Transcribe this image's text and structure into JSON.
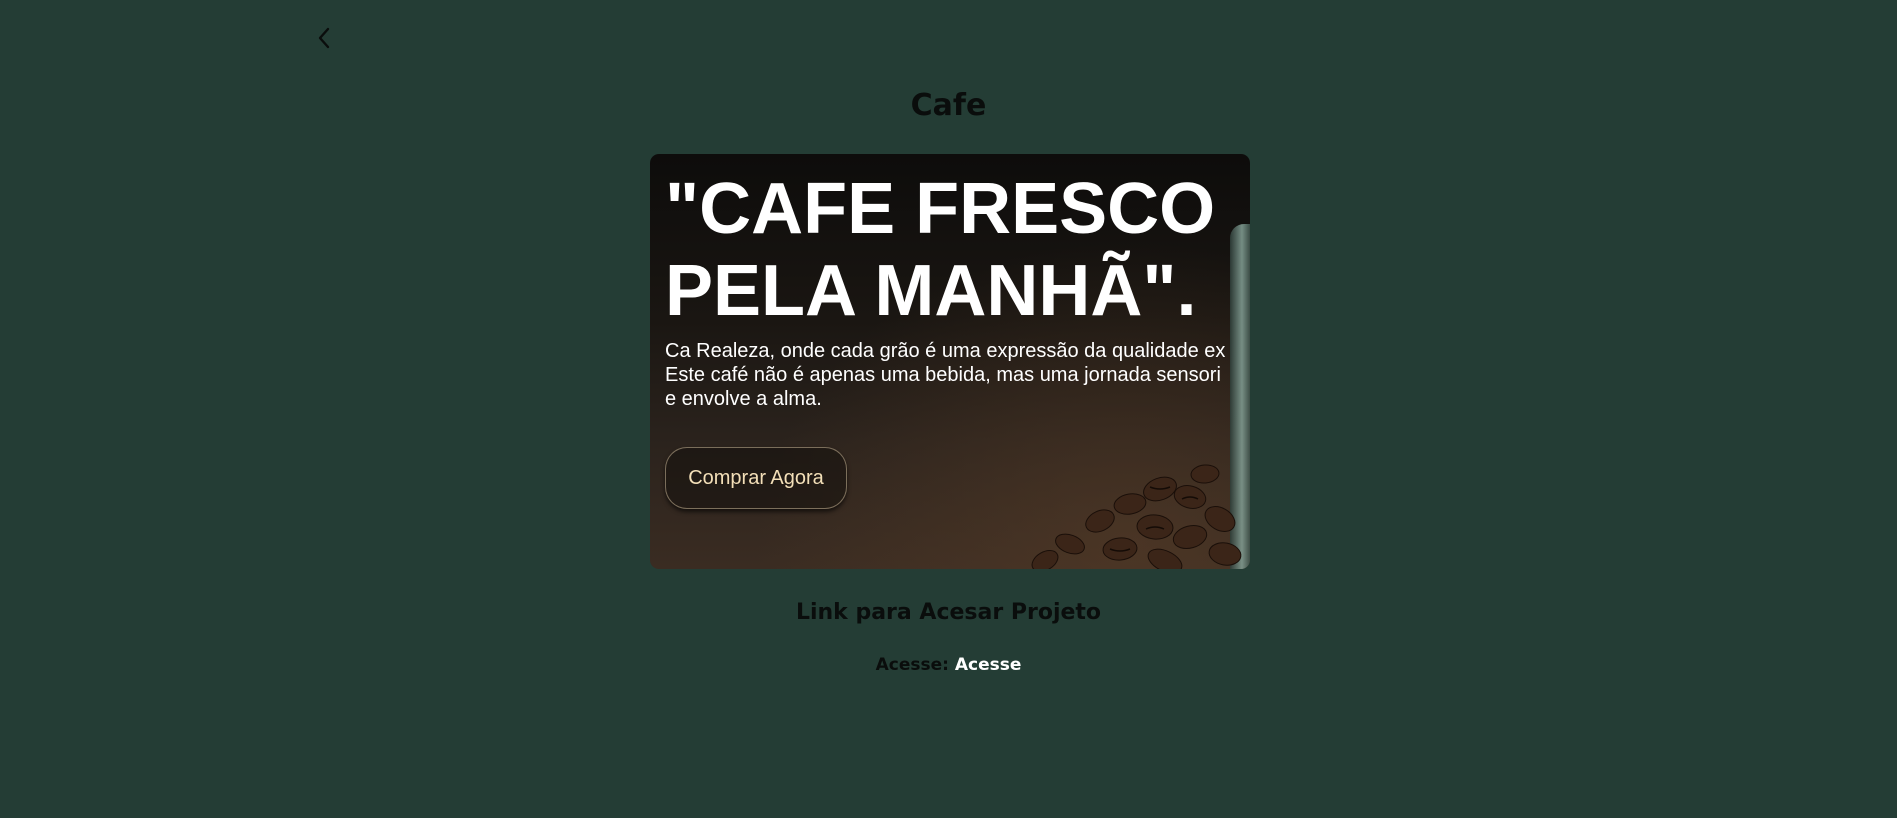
{
  "header": {
    "back_icon": "chevron-left-icon",
    "title": "Cafe"
  },
  "card": {
    "heading": "\"CAFE FRESCO\nPELA MANHÃ\".",
    "description": "Ca Realeza, onde cada grão é uma expressão da qualidade ex\nEste café não é apenas uma bebida, mas uma jornada sensori\ne envolve a alma.",
    "button_label": "Comprar Agora"
  },
  "link_section": {
    "heading": "Link para Acesar Projeto",
    "prefix": "Acesse:",
    "link_label": "Acesse"
  },
  "colors": {
    "background": "#243d35",
    "link": "#ffffff",
    "button_text": "#f3dfb8"
  }
}
